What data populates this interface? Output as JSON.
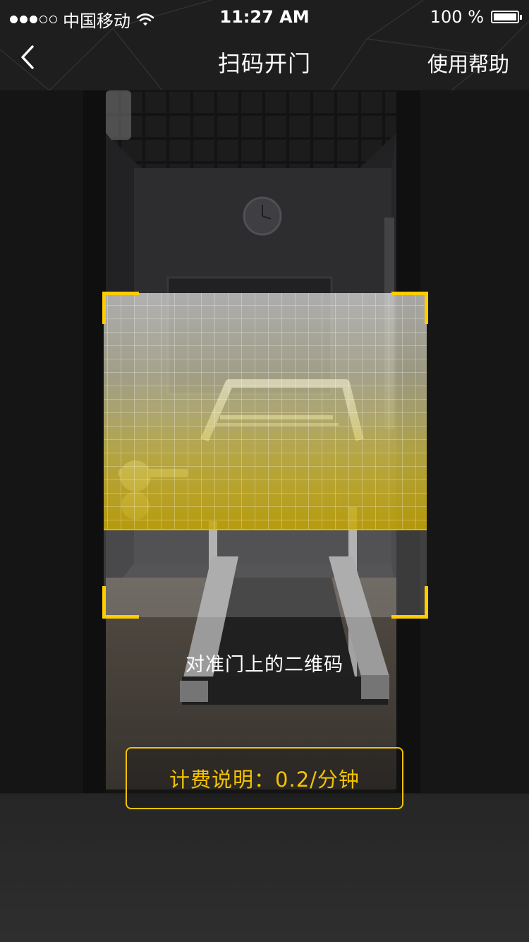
{
  "status_bar": {
    "carrier": "中国移动",
    "time": "11:27 AM",
    "battery_percent": "100 %",
    "signal_strength": 3,
    "signal_total": 5
  },
  "nav": {
    "back_icon": "chevron-left-icon",
    "title": "扫码开门",
    "help_label": "使用帮助"
  },
  "scanner": {
    "hint": "对准门上的二维码",
    "frame_color": "#ffcc00"
  },
  "pricing": {
    "label": "计费说明：0.2/分钟",
    "color": "#f4c200"
  }
}
